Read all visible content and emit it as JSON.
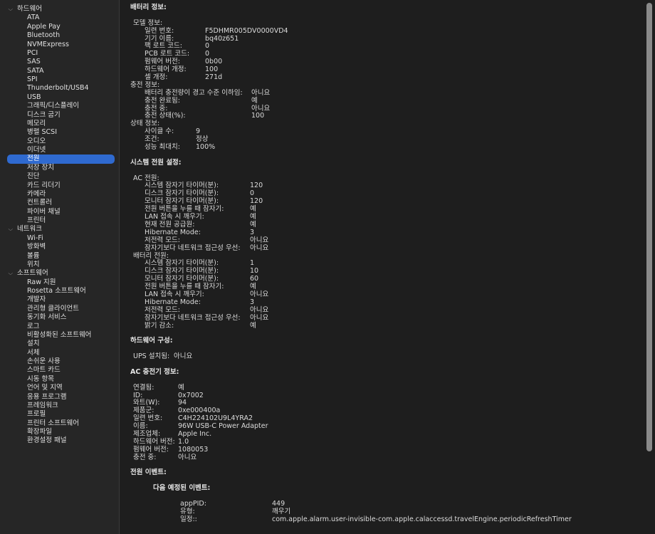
{
  "sidebar": [
    {
      "label": "하드웨어",
      "group": true
    },
    {
      "label": "ATA"
    },
    {
      "label": "Apple Pay"
    },
    {
      "label": "Bluetooth"
    },
    {
      "label": "NVMExpress"
    },
    {
      "label": "PCI"
    },
    {
      "label": "SAS"
    },
    {
      "label": "SATA"
    },
    {
      "label": "SPI"
    },
    {
      "label": "Thunderbolt/USB4"
    },
    {
      "label": "USB"
    },
    {
      "label": "그래픽/디스플레이"
    },
    {
      "label": "디스크 굽기"
    },
    {
      "label": "메모리"
    },
    {
      "label": "병렬 SCSI"
    },
    {
      "label": "오디오"
    },
    {
      "label": "이더넷"
    },
    {
      "label": "전원",
      "selected": true
    },
    {
      "label": "저장 장치"
    },
    {
      "label": "진단"
    },
    {
      "label": "카드 리더기"
    },
    {
      "label": "카메라"
    },
    {
      "label": "컨트롤러"
    },
    {
      "label": "파이버 채널"
    },
    {
      "label": "프린터"
    },
    {
      "label": "네트워크",
      "group": true
    },
    {
      "label": "Wi-Fi"
    },
    {
      "label": "방화벽"
    },
    {
      "label": "볼륨"
    },
    {
      "label": "위치"
    },
    {
      "label": "소프트웨어",
      "group": true
    },
    {
      "label": "Raw 지원"
    },
    {
      "label": "Rosetta 소프트웨어"
    },
    {
      "label": "개발자"
    },
    {
      "label": "관리형 클라이언트"
    },
    {
      "label": "동기화 서비스"
    },
    {
      "label": "로그"
    },
    {
      "label": "비활성화된 소프트웨어"
    },
    {
      "label": "설치"
    },
    {
      "label": "서체"
    },
    {
      "label": "손쉬운 사용"
    },
    {
      "label": "스마트 카드"
    },
    {
      "label": "시동 항목"
    },
    {
      "label": "언어 및 지역"
    },
    {
      "label": "응용 프로그램"
    },
    {
      "label": "프레임워크"
    },
    {
      "label": "프로필"
    },
    {
      "label": "프린터 소프트웨어"
    },
    {
      "label": "확장파일"
    },
    {
      "label": "환경설정 패널"
    }
  ],
  "content": [
    {
      "t": "title",
      "k": "배터리 정보:"
    },
    {
      "t": "gap"
    },
    {
      "t": "row",
      "i": 1,
      "k": "모델 정보:"
    },
    {
      "t": "row",
      "i": 2,
      "k": "일련 번호:",
      "v": "F5DHMR005DV0000VD4",
      "c": 1
    },
    {
      "t": "row",
      "i": 2,
      "k": "기기 이름:",
      "v": "bq40z651",
      "c": 1
    },
    {
      "t": "row",
      "i": 2,
      "k": "팩 로트 코드:",
      "v": "0",
      "c": 1
    },
    {
      "t": "row",
      "i": 2,
      "k": "PCB 로트 코드:",
      "v": "0",
      "c": 1
    },
    {
      "t": "row",
      "i": 2,
      "k": "펌웨어 버전:",
      "v": "0b00",
      "c": 1
    },
    {
      "t": "row",
      "i": 2,
      "k": "하드웨어 개정:",
      "v": "100",
      "c": 1
    },
    {
      "t": "row",
      "i": 2,
      "k": "셀 개정:",
      "v": "271d",
      "c": 1
    },
    {
      "t": "row",
      "i": 0,
      "k": "충전 정보:"
    },
    {
      "t": "row",
      "i": 2,
      "k": "배터리 충전량이 경고 수준 이하임:",
      "v": "아니요",
      "c": 2
    },
    {
      "t": "row",
      "i": 2,
      "k": "충전 완료됨:",
      "v": "예",
      "c": 2
    },
    {
      "t": "row",
      "i": 2,
      "k": "충전 중:",
      "v": "아니요",
      "c": 2
    },
    {
      "t": "row",
      "i": 2,
      "k": "충전 상태(%):",
      "v": "100",
      "c": 2
    },
    {
      "t": "row",
      "i": 0,
      "k": "상태 정보:"
    },
    {
      "t": "row",
      "i": 2,
      "k": "사이클 수:",
      "v": "9",
      "c": 3
    },
    {
      "t": "row",
      "i": 2,
      "k": "조건:",
      "v": "정상",
      "c": 3
    },
    {
      "t": "row",
      "i": 2,
      "k": "성능 최대치:",
      "v": "100%",
      "c": 3
    },
    {
      "t": "gap"
    },
    {
      "t": "title",
      "k": "시스템 전원 설정:"
    },
    {
      "t": "gap"
    },
    {
      "t": "row",
      "i": 1,
      "k": "AC 전원:"
    },
    {
      "t": "row",
      "i": 2,
      "k": "시스템 잠자기 타이머(분):",
      "v": "120",
      "c": 4
    },
    {
      "t": "row",
      "i": 2,
      "k": "디스크 잠자기 타이머(분):",
      "v": "0",
      "c": 4
    },
    {
      "t": "row",
      "i": 2,
      "k": "모니터 잠자기 타이머(분):",
      "v": "120",
      "c": 4
    },
    {
      "t": "row",
      "i": 2,
      "k": "전원 버튼을 누를 때 잠자기:",
      "v": "예",
      "c": 4
    },
    {
      "t": "row",
      "i": 2,
      "k": "LAN 접속 시 깨우기:",
      "v": "예",
      "c": 4
    },
    {
      "t": "row",
      "i": 2,
      "k": "현재 전원 공급원:",
      "v": "예",
      "c": 4
    },
    {
      "t": "row",
      "i": 2,
      "k": "Hibernate Mode:",
      "v": "3",
      "c": 4
    },
    {
      "t": "row",
      "i": 2,
      "k": "저전력 모드:",
      "v": "아니요",
      "c": 4
    },
    {
      "t": "row",
      "i": 2,
      "k": "잠자기보다 네트워크 접근성 우선:",
      "v": "아니요",
      "c": 4
    },
    {
      "t": "row",
      "i": 1,
      "k": "배터리 전원:"
    },
    {
      "t": "row",
      "i": 2,
      "k": "시스템 잠자기 타이머(분):",
      "v": "1",
      "c": 4
    },
    {
      "t": "row",
      "i": 2,
      "k": "디스크 잠자기 타이머(분):",
      "v": "10",
      "c": 4
    },
    {
      "t": "row",
      "i": 2,
      "k": "모니터 잠자기 타이머(분):",
      "v": "60",
      "c": 4
    },
    {
      "t": "row",
      "i": 2,
      "k": "전원 버튼을 누를 때 잠자기:",
      "v": "예",
      "c": 4
    },
    {
      "t": "row",
      "i": 2,
      "k": "LAN 접속 시 깨우기:",
      "v": "아니요",
      "c": 4
    },
    {
      "t": "row",
      "i": 2,
      "k": "Hibernate Mode:",
      "v": "3",
      "c": 4
    },
    {
      "t": "row",
      "i": 2,
      "k": "저전력 모드:",
      "v": "아니요",
      "c": 4
    },
    {
      "t": "row",
      "i": 2,
      "k": "잠자기보다 네트워크 접근성 우선:",
      "v": "아니요",
      "c": 4
    },
    {
      "t": "row",
      "i": 2,
      "k": "밝기 감소:",
      "v": "예",
      "c": 4
    },
    {
      "t": "gap"
    },
    {
      "t": "title",
      "k": "하드웨어 구성:"
    },
    {
      "t": "gap"
    },
    {
      "t": "row",
      "i": 1,
      "k": "UPS 설치됨:",
      "v": "아니요",
      "c": 5
    },
    {
      "t": "gap"
    },
    {
      "t": "title",
      "k": "AC 충전기 정보:"
    },
    {
      "t": "gap"
    },
    {
      "t": "row",
      "i": 1,
      "k": "연결됨:",
      "v": "예",
      "c": 6
    },
    {
      "t": "row",
      "i": 1,
      "k": "ID:",
      "v": "0x7002",
      "c": 6
    },
    {
      "t": "row",
      "i": 1,
      "k": "와트(W):",
      "v": "94",
      "c": 6
    },
    {
      "t": "row",
      "i": 1,
      "k": "제품군:",
      "v": "0xe000400a",
      "c": 6
    },
    {
      "t": "row",
      "i": 1,
      "k": "일련 번호:",
      "v": "C4H224102U9L4YRA2",
      "c": 6
    },
    {
      "t": "row",
      "i": 1,
      "k": "이름:",
      "v": "96W USB-C Power Adapter",
      "c": 6
    },
    {
      "t": "row",
      "i": 1,
      "k": "제조업체:",
      "v": "Apple Inc.",
      "c": 6
    },
    {
      "t": "row",
      "i": 1,
      "k": "하드웨어 버전:",
      "v": "1.0",
      "c": 6
    },
    {
      "t": "row",
      "i": 1,
      "k": "펌웨어 버전:",
      "v": "1080053",
      "c": 6
    },
    {
      "t": "row",
      "i": 1,
      "k": "충전 중:",
      "v": "아니요",
      "c": 6
    },
    {
      "t": "gap"
    },
    {
      "t": "title",
      "k": "전원 이벤트:"
    },
    {
      "t": "gap"
    },
    {
      "t": "title",
      "i": 3,
      "k": "다음 예정된 이벤트:"
    },
    {
      "t": "gap"
    },
    {
      "t": "row",
      "i": 4,
      "k": "appPID:",
      "v": "449",
      "c": 7
    },
    {
      "t": "row",
      "i": 4,
      "k": "유형:",
      "v": "깨우기",
      "c": 7
    },
    {
      "t": "row",
      "i": 4,
      "k": "일정::",
      "v": "com.apple.alarm.user-invisible-com.apple.calaccessd.travelEngine.periodicRefreshTimer",
      "c": 7
    }
  ]
}
